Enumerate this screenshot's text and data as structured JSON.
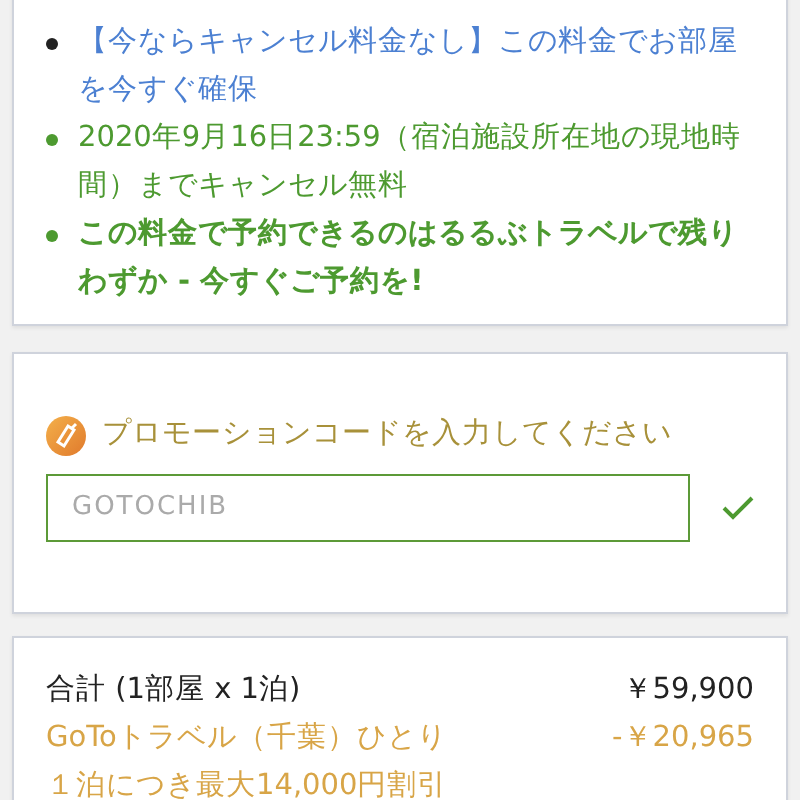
{
  "notes": [
    {
      "kind": "link",
      "text": "【今ならキャンセル料金なし】この料金でお部屋を今すぐ確保"
    },
    {
      "kind": "info",
      "text": "2020年9月16日23:59（宿泊施設所在地の現地時間）までキャンセル無料"
    },
    {
      "kind": "urgent",
      "text": "この料金で予約できるのはるるぶトラベルで残りわずか - 今すぐご予約を!"
    }
  ],
  "promo": {
    "label": "プロモーションコードを入力してください",
    "value": "GOTOCHIB",
    "valid": true
  },
  "summary": [
    {
      "kind": "total",
      "label": "合計 (1部屋 x 1泊)",
      "amount": "￥59,900"
    },
    {
      "kind": "discount",
      "label": "GoToトラベル（千葉）ひとり",
      "amount": "-￥20,965"
    },
    {
      "kind": "discount-note",
      "label": "１泊につき最大14,000円割引"
    }
  ]
}
